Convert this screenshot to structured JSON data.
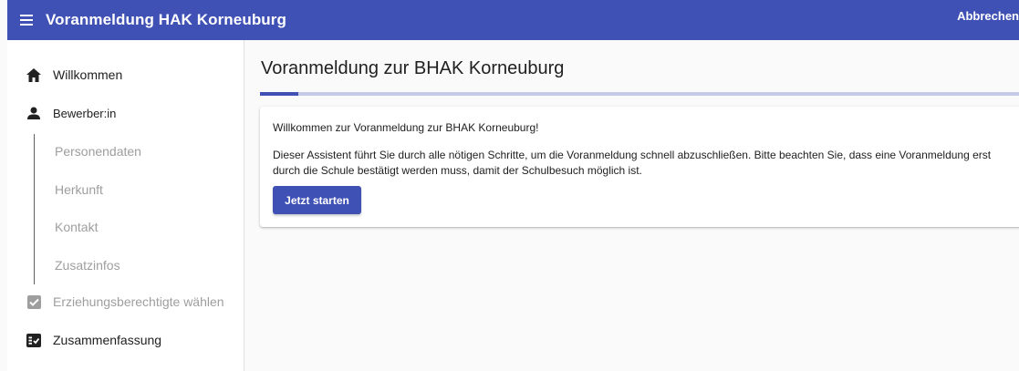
{
  "header": {
    "title": "Voranmeldung HAK Korneuburg",
    "cancel_label": "Abbrechen",
    "color": "#3f51b5"
  },
  "sidebar": {
    "items": [
      {
        "label": "Willkommen",
        "icon": "home-icon",
        "state": "active"
      },
      {
        "label": "Bewerber:in",
        "icon": "person-icon",
        "state": "active"
      },
      {
        "label": "Erziehungsberechtigte wählen",
        "icon": "checkbox-icon",
        "state": "disabled"
      },
      {
        "label": "Zusammenfassung",
        "icon": "checklist-icon",
        "state": "active"
      }
    ],
    "subitems": [
      {
        "label": "Personendaten"
      },
      {
        "label": "Herkunft"
      },
      {
        "label": "Kontakt"
      },
      {
        "label": "Zusatzinfos"
      }
    ]
  },
  "main": {
    "title": "Voranmeldung zur BHAK Korneuburg",
    "progress": 0.05,
    "card": {
      "heading": "Willkommen zur Voranmeldung zur BHAK Korneuburg!",
      "text": "Dieser Assistent führt Sie durch alle nötigen Schritte, um die Voranmeldung schnell abzuschließen. Bitte beachten Sie, dass eine Voranmeldung erst durch die Schule bestätigt werden muss, damit der Schulbesuch möglich ist.",
      "button_label": "Jetzt starten"
    }
  },
  "colors": {
    "accent": "#3f51b5",
    "progress_track": "#c5cae9",
    "disabled_text": "#9e9e9e"
  }
}
